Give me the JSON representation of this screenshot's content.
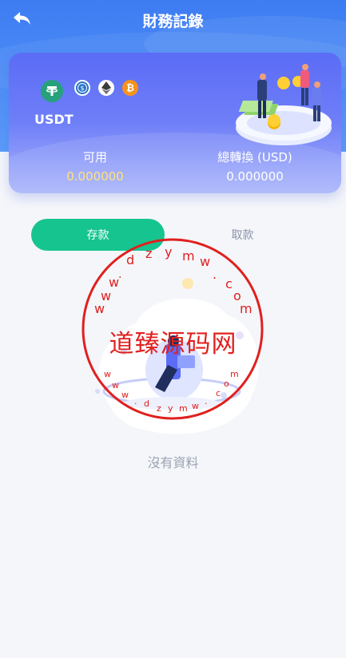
{
  "header": {
    "title": "財務記錄"
  },
  "card": {
    "asset": "USDT",
    "coins": [
      "usdt-icon",
      "usdc-icon",
      "eth-icon",
      "btc-icon"
    ],
    "available_label": "可用",
    "available_value": "0.000000",
    "usd_label": "總轉換 (USD)",
    "usd_value": "0.000000"
  },
  "tabs": [
    {
      "label": "存款",
      "active": true
    },
    {
      "label": "取款",
      "active": false
    }
  ],
  "empty": {
    "text": "沒有資料"
  },
  "watermark": {
    "text": "道臻源码网",
    "ring_top": "dzymw.com",
    "ring_bottom": "www.dzymw.com"
  },
  "colors": {
    "header": "#3d7cf2",
    "card": "#5b6cf6",
    "accent": "#16c48f",
    "available_value": "#ffe27a",
    "watermark": "#e0201f"
  }
}
